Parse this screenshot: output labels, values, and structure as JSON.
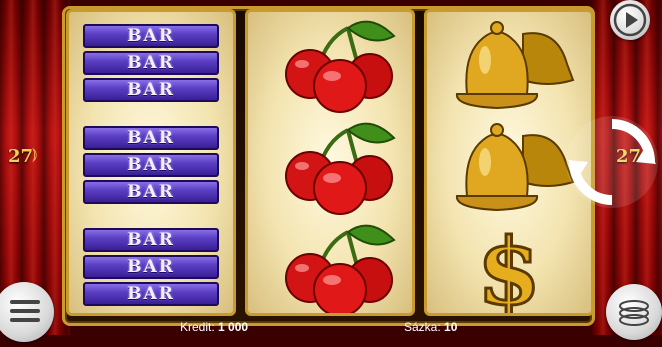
{
  "game": {
    "lines_count": "27",
    "reels": [
      {
        "symbols": [
          "bar-triple",
          "bar-triple",
          "bar-triple"
        ]
      },
      {
        "symbols": [
          "cherry",
          "cherry",
          "cherry"
        ]
      },
      {
        "symbols": [
          "bell",
          "bell",
          "dollar"
        ]
      }
    ],
    "bar_label": "BAR"
  },
  "footer": {
    "credit_label": "Kredit:",
    "credit_value": "1 000",
    "bet_label": "Sázka:",
    "bet_value": "10"
  },
  "colors": {
    "gold": "#c99a2e",
    "curtain_red": "#b30f0f",
    "bar_purple": "#5a3fc4"
  }
}
